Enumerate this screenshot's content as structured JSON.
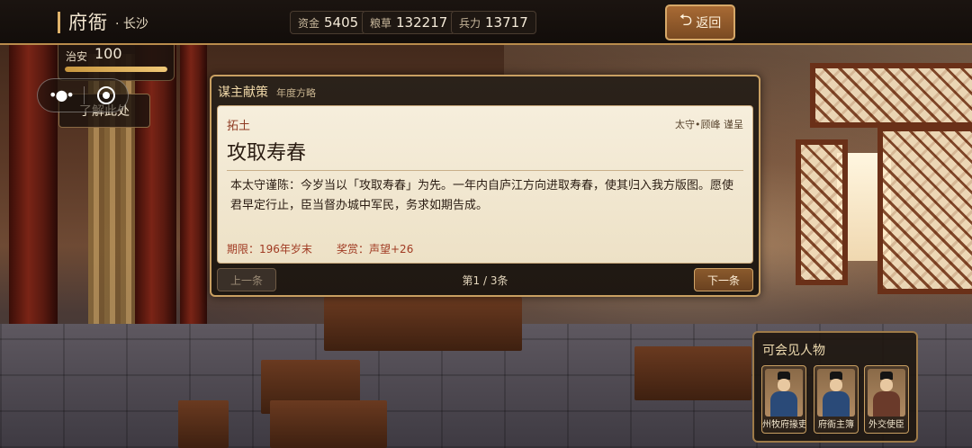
{
  "header": {
    "title": "府衙",
    "location": "· 长沙",
    "resources": [
      {
        "label": "资金",
        "value": "5405"
      },
      {
        "label": "粮草",
        "value": "132217"
      },
      {
        "label": "兵力",
        "value": "13717"
      }
    ],
    "back_label": "返回",
    "back_icon": "return-arrow-icon"
  },
  "order": {
    "label": "治安",
    "value": "100",
    "level_fraction": 1.0
  },
  "mini_program": {
    "more_icon": "more-dots-icon",
    "close_icon": "target-circle-icon"
  },
  "learn_button": {
    "label": "了解此处"
  },
  "proposal": {
    "title": "谋主献策",
    "subtitle": "年度方略",
    "category": "拓土",
    "author": "太守•顾峰 谨呈",
    "heading": "攻取寿春",
    "body": "本太守谨陈：今岁当以「攻取寿春」为先。一年内自庐江方向进取寿春，使其归入我方版图。愿使君早定行止，臣当督办城中军民，务求如期告成。",
    "deadline": "期限：196年岁末",
    "reward": "奖赏：声望+26",
    "prev_label": "上一条",
    "next_label": "下一条",
    "page_indicator": "第1 / 3条"
  },
  "visitors": {
    "title": "可会见人物",
    "people": [
      {
        "name": "州牧府掾吏",
        "robe_color": "#2a4a78"
      },
      {
        "name": "府衙主簿",
        "robe_color": "#2a4a78"
      },
      {
        "name": "外交使臣",
        "robe_color": "#6a3a2a"
      }
    ]
  },
  "colors": {
    "accent_gold": "#c9a062",
    "alert_red": "#a03a22"
  }
}
